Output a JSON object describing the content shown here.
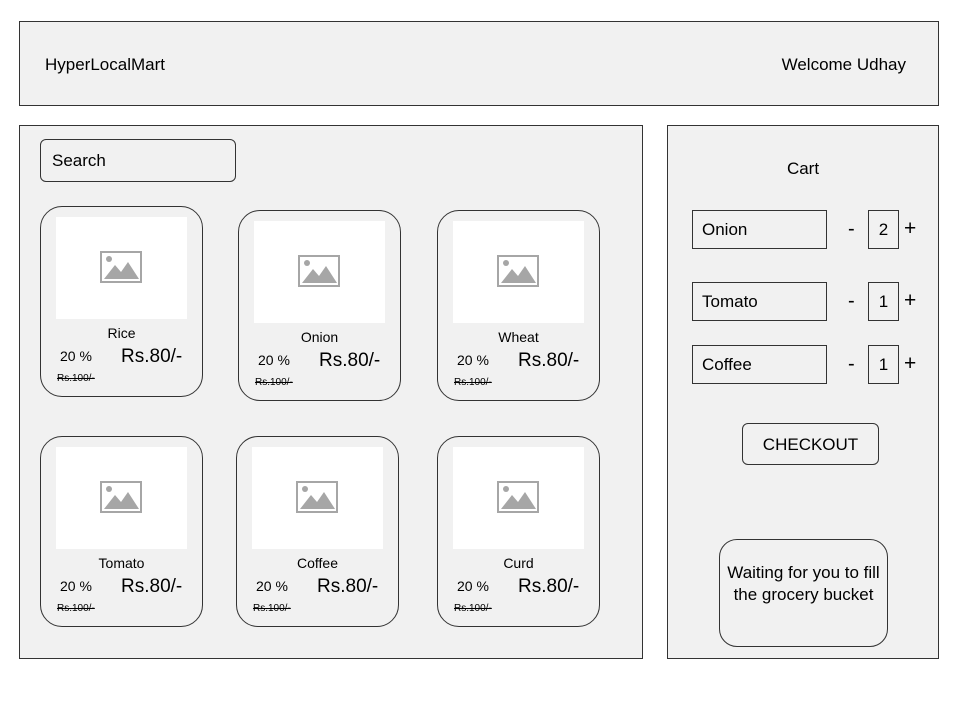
{
  "header": {
    "brand": "HyperLocalMart",
    "welcome": "Welcome Udhay"
  },
  "search": {
    "placeholder": "Search"
  },
  "products": [
    {
      "name": "Rice",
      "discount": "20 %",
      "price": "Rs.80/-",
      "old_price": "Rs.100/-"
    },
    {
      "name": "Onion",
      "discount": "20 %",
      "price": "Rs.80/-",
      "old_price": "Rs.100/-"
    },
    {
      "name": "Wheat",
      "discount": "20 %",
      "price": "Rs.80/-",
      "old_price": "Rs.100/-"
    },
    {
      "name": "Tomato",
      "discount": "20 %",
      "price": "Rs.80/-",
      "old_price": "Rs.100/-"
    },
    {
      "name": "Coffee",
      "discount": "20 %",
      "price": "Rs.80/-",
      "old_price": "Rs.100/-"
    },
    {
      "name": "Curd",
      "discount": "20 %",
      "price": "Rs.80/-",
      "old_price": "Rs.100/-"
    }
  ],
  "cart": {
    "title": "Cart",
    "items": [
      {
        "name": "Onion",
        "qty": "2",
        "minus": "-",
        "plus": "+"
      },
      {
        "name": "Tomato",
        "qty": "1",
        "minus": "-",
        "plus": "+"
      },
      {
        "name": "Coffee",
        "qty": "1",
        "minus": "-",
        "plus": "+"
      }
    ],
    "checkout_label": "CHECKOUT",
    "waiting_message": "Waiting for you to fill the grocery bucket"
  },
  "icons": {
    "product_image": "image-placeholder-icon"
  }
}
